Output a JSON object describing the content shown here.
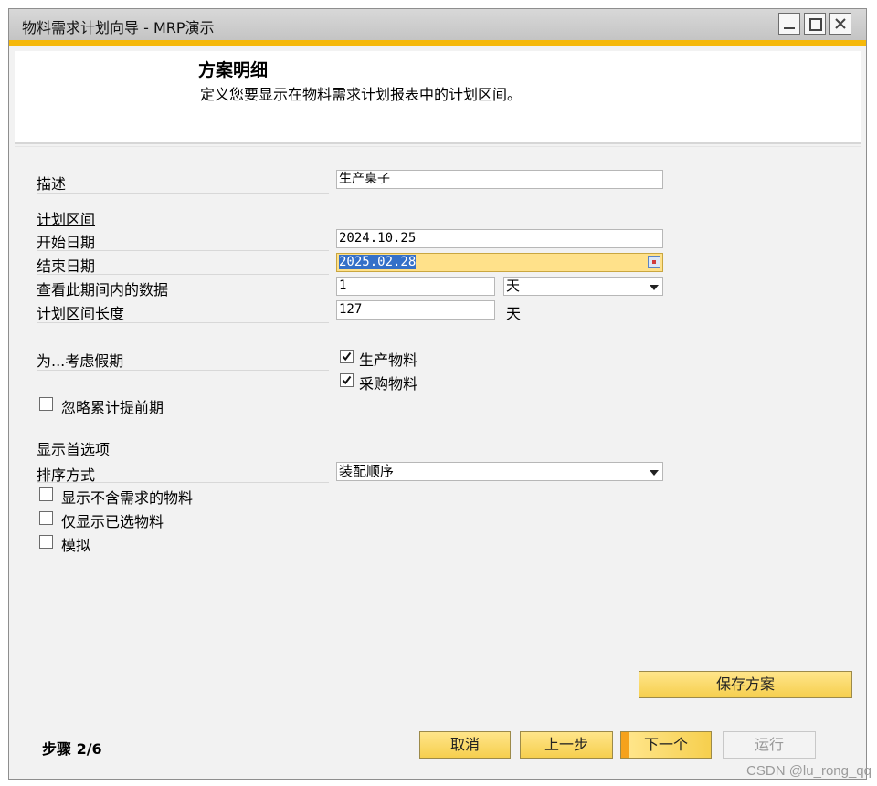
{
  "window": {
    "title": "物料需求计划向导 - MRP演示",
    "controls": [
      "minimize-icon",
      "maximize-icon",
      "close-icon"
    ]
  },
  "header": {
    "title": "方案明细",
    "subtitle": "定义您要显示在物料需求计划报表中的计划区间。"
  },
  "form": {
    "description_label": "描述",
    "description_value": "生产桌子",
    "planning_period_heading": "计划区间",
    "start_date_label": "开始日期",
    "start_date_value": "2024.10.25",
    "end_date_label": "结束日期",
    "end_date_value": "2025.02.28",
    "view_data_label": "查看此期间内的数据",
    "view_data_value": "1",
    "view_data_unit": "天",
    "period_length_label": "计划区间长度",
    "period_length_value": "127",
    "period_length_unit": "天",
    "holidays_label": "为...考虑假期",
    "production_items_label": "生产物料",
    "production_items_checked": true,
    "purchase_items_label": "采购物料",
    "purchase_items_checked": true,
    "ignore_lead_time_label": "忽略累计提前期",
    "ignore_lead_time_checked": false,
    "display_options_heading": "显示首选项",
    "sort_label": "排序方式",
    "sort_value": "装配顺序",
    "show_no_demand_label": "显示不含需求的物料",
    "show_no_demand_checked": false,
    "show_selected_only_label": "仅显示已选物料",
    "show_selected_only_checked": false,
    "simulate_label": "模拟",
    "simulate_checked": false
  },
  "buttons": {
    "save": "保存方案",
    "cancel": "取消",
    "prev": "上一步",
    "next": "下一个",
    "run": "运行"
  },
  "footer": {
    "step": "步骤 2/6"
  },
  "watermark": "CSDN @lu_rong_qq",
  "colors": {
    "accent": "#f5b80a",
    "button": "#f6cf4e",
    "selection": "#3470c8",
    "selected_field": "#ffe18a"
  }
}
